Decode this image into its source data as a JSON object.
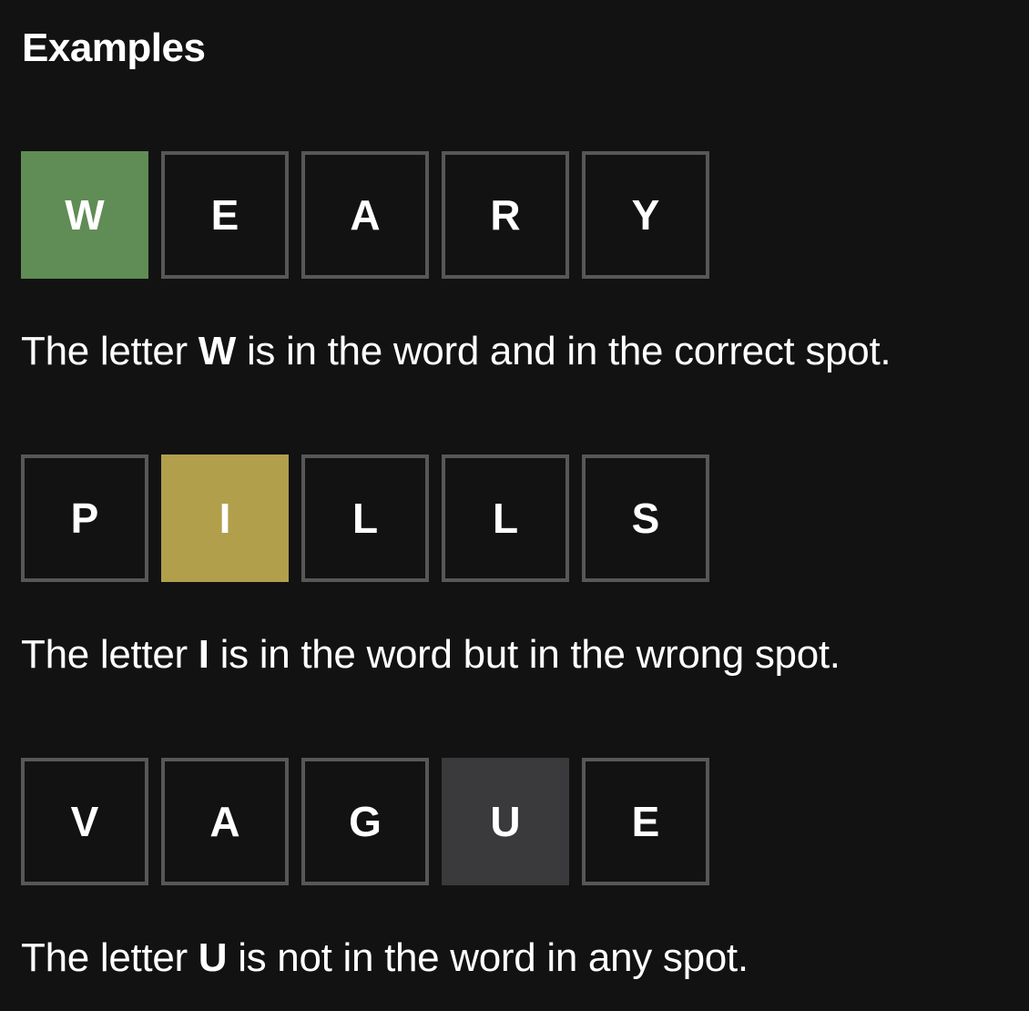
{
  "heading": "Examples",
  "examples": [
    {
      "tiles": [
        {
          "letter": "W",
          "state": "correct"
        },
        {
          "letter": "E",
          "state": "empty"
        },
        {
          "letter": "A",
          "state": "empty"
        },
        {
          "letter": "R",
          "state": "empty"
        },
        {
          "letter": "Y",
          "state": "empty"
        }
      ],
      "desc_prefix": "The letter ",
      "desc_letter": "W",
      "desc_suffix": " is in the word and in the correct spot."
    },
    {
      "tiles": [
        {
          "letter": "P",
          "state": "empty"
        },
        {
          "letter": "I",
          "state": "present"
        },
        {
          "letter": "L",
          "state": "empty"
        },
        {
          "letter": "L",
          "state": "empty"
        },
        {
          "letter": "S",
          "state": "empty"
        }
      ],
      "desc_prefix": "The letter ",
      "desc_letter": "I",
      "desc_suffix": " is in the word but in the wrong spot."
    },
    {
      "tiles": [
        {
          "letter": "V",
          "state": "empty"
        },
        {
          "letter": "A",
          "state": "empty"
        },
        {
          "letter": "G",
          "state": "empty"
        },
        {
          "letter": "U",
          "state": "absent"
        },
        {
          "letter": "E",
          "state": "empty"
        }
      ],
      "desc_prefix": "The letter ",
      "desc_letter": "U",
      "desc_suffix": " is not in the word in any spot."
    }
  ],
  "colors": {
    "background": "#121213",
    "correct": "#608c55",
    "present": "#b19f4c",
    "absent": "#3a3a3c",
    "tile_border": "#565758"
  }
}
